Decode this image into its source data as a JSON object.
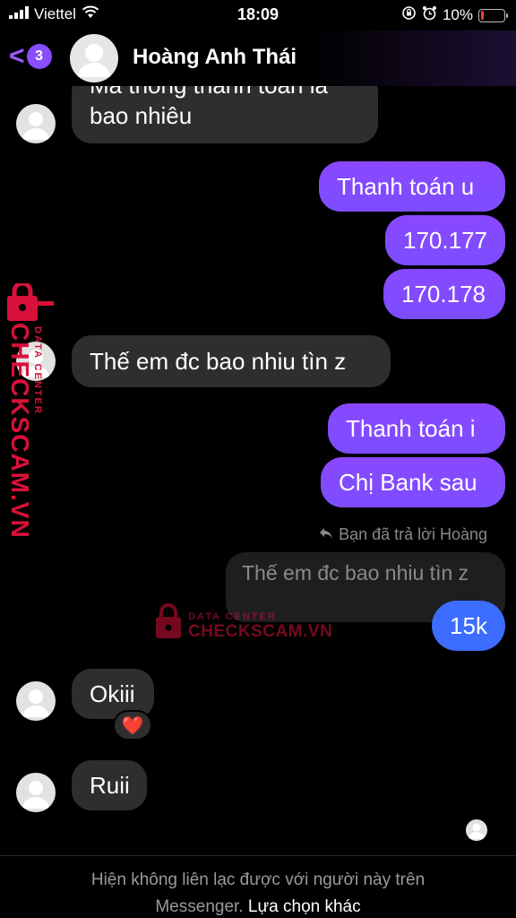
{
  "status_bar": {
    "carrier": "Viettel",
    "time": "18:09",
    "battery_percent": "10%",
    "battery_level": 0.1,
    "icons": [
      "signal-icon",
      "wifi-icon",
      "lock-rotation-icon",
      "alarm-icon",
      "battery-icon"
    ]
  },
  "header": {
    "back_count": "3",
    "contact_name": "Hoàng Anh Thái"
  },
  "messages": {
    "m1": "Mã thông thanh toán là bao nhiêu",
    "m1_line1": "Mã thông thanh toán là",
    "m1_line2": "bao nhiêu",
    "m2": "Thanh toán u",
    "m3": "170.177",
    "m4": "170.178",
    "m5": "Thế em đc bao nhiu tìn z",
    "m6": "Thanh toán i",
    "m7": "Chị Bank sau",
    "reply_note": "Bạn đã trả lời Hoàng",
    "quoted": "Thế em đc bao nhiu tìn z",
    "m8": "15k",
    "m9": "Okiii",
    "m9_reaction": "❤️",
    "m10": "Ruii"
  },
  "watermark": {
    "brand": "CHECKSCAM.VN",
    "sub": "DATA CENTER"
  },
  "footer": {
    "notice": "Hiện không liên lạc được với người này trên",
    "notice_2": "Messenger.",
    "action": "Lựa chọn khác"
  },
  "colors": {
    "outgoing": "#7c4dff",
    "outgoing_blue": "#3d6dff",
    "incoming": "#2e2e30",
    "watermark": "#d8113a",
    "accent": "#9b5cff"
  }
}
